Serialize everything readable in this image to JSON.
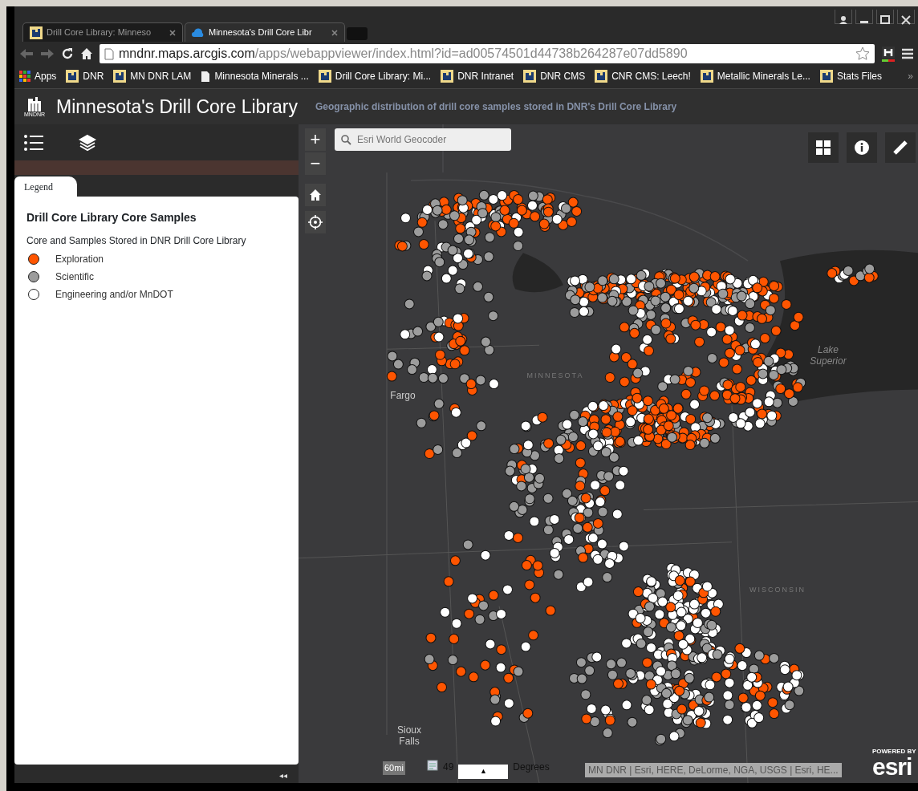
{
  "browser": {
    "tabs": [
      {
        "title": "Drill Core Library: Minneso",
        "selected": false
      },
      {
        "title": "Minnesota's Drill Core Libr",
        "selected": true
      }
    ],
    "address": {
      "host": "mndnr.maps.arcgis.com",
      "path": "/apps/webappviewer/index.html?id=ad00574501d44738b264287e07dd5890"
    },
    "bookmarks": [
      {
        "label": "Apps",
        "kind": "apps"
      },
      {
        "label": "DNR",
        "kind": "site"
      },
      {
        "label": "MN DNR LAM",
        "kind": "site"
      },
      {
        "label": "Minnesota Minerals ...",
        "kind": "page"
      },
      {
        "label": "Drill Core Library: Mi...",
        "kind": "site"
      },
      {
        "label": "DNR Intranet",
        "kind": "site"
      },
      {
        "label": "DNR CMS",
        "kind": "site"
      },
      {
        "label": "CNR CMS: Leech!",
        "kind": "site"
      },
      {
        "label": "Metallic Minerals Le...",
        "kind": "site"
      },
      {
        "label": "Stats Files",
        "kind": "site"
      }
    ],
    "more": "»"
  },
  "app": {
    "logo_text": "MNDNR",
    "title": "Minnesota's Drill Core Library",
    "subtitle": "Geographic distribution of drill core samples stored in DNR's Drill Core Library"
  },
  "panel": {
    "tab": "Legend",
    "layer_title": "Drill Core Library Core Samples",
    "layer_subtitle": "Core and Samples Stored in DNR Drill Core Library",
    "legend": [
      {
        "label": "Exploration",
        "color": "#ff5500"
      },
      {
        "label": "Scientific",
        "color": "#9c9c9c"
      },
      {
        "label": "Engineering and/or MnDOT",
        "color": "#ffffff"
      }
    ],
    "collapse": "◂◂"
  },
  "map": {
    "search_placeholder": "Esri World Geocoder",
    "zoom_in": "+",
    "zoom_out": "−",
    "labels": [
      {
        "text": "MINNESOTA",
        "kind": "state"
      },
      {
        "text": "Fargo",
        "kind": "city"
      },
      {
        "text": "Lake Superior",
        "kind": "water"
      },
      {
        "text": "WISCONSIN",
        "kind": "state"
      },
      {
        "text": "Sioux Falls",
        "kind": "city"
      }
    ],
    "scale": "60mi",
    "coordinates_start": "49",
    "coordinates_end": "Degrees",
    "attribution": "MN DNR | Esri, HERE, DeLorme, NGA, USGS | Esri, HE...",
    "powered_by": "POWERED BY",
    "esri": "esri",
    "toggle": "▲"
  }
}
